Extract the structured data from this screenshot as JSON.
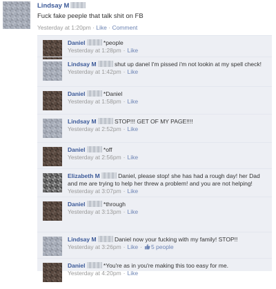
{
  "post": {
    "author": "Lindsay M",
    "message": "Fuck fake peeple that talk shit on FB",
    "time": "Yesterday at 1:20pm",
    "like_label": "Like",
    "comment_label": "Comment",
    "separator": "·"
  },
  "comments": [
    {
      "author": "Daniel",
      "text": "*people",
      "time": "Yesterday at 1:28pm",
      "like_label": "Like"
    },
    {
      "author": "Lindsay M",
      "text": "shut up danel I'm pissed i'm not lookin at my spell check!",
      "time": "Yesterday at 1:42pm",
      "like_label": "Like"
    },
    {
      "author": "Daniel",
      "text": "*Daniel",
      "time": "Yesterday at 1:58pm",
      "like_label": "Like"
    },
    {
      "author": "Lindsay M",
      "text": "STOP!!! GET OF MY PAGE!!!!",
      "time": "Yesterday at 2:52pm",
      "like_label": "Like"
    },
    {
      "author": "Daniel",
      "text": "*off",
      "time": "Yesterday at 2:56pm",
      "like_label": "Like"
    },
    {
      "author": "Elizabeth M",
      "text": "Daniel, please stop! she has had a rough day! her Dad and me are trying to help her threw a problem! and you are not helping!",
      "time": "Yesterday at 3:07pm",
      "like_label": "Like"
    },
    {
      "author": "Daniel",
      "text": "*through",
      "time": "Yesterday at 3:13pm",
      "like_label": "Like"
    },
    {
      "author": "Lindsay M",
      "text": "Daniel now your fucking with my family! STOP!!",
      "time": "Yesterday at 3:26pm",
      "like_label": "Like",
      "likes_count": "5 people"
    },
    {
      "author": "Daniel",
      "text": "*You're as in you're making this too easy for me.",
      "time": "Yesterday at 4:20pm",
      "like_label": "Like"
    }
  ],
  "colors": {
    "name_link": "#3b5998",
    "action_link": "#6d84b4",
    "meta_gray": "#999999",
    "comment_bg": "#edeff4"
  },
  "icons": {
    "like": "thumbs-up-icon"
  }
}
